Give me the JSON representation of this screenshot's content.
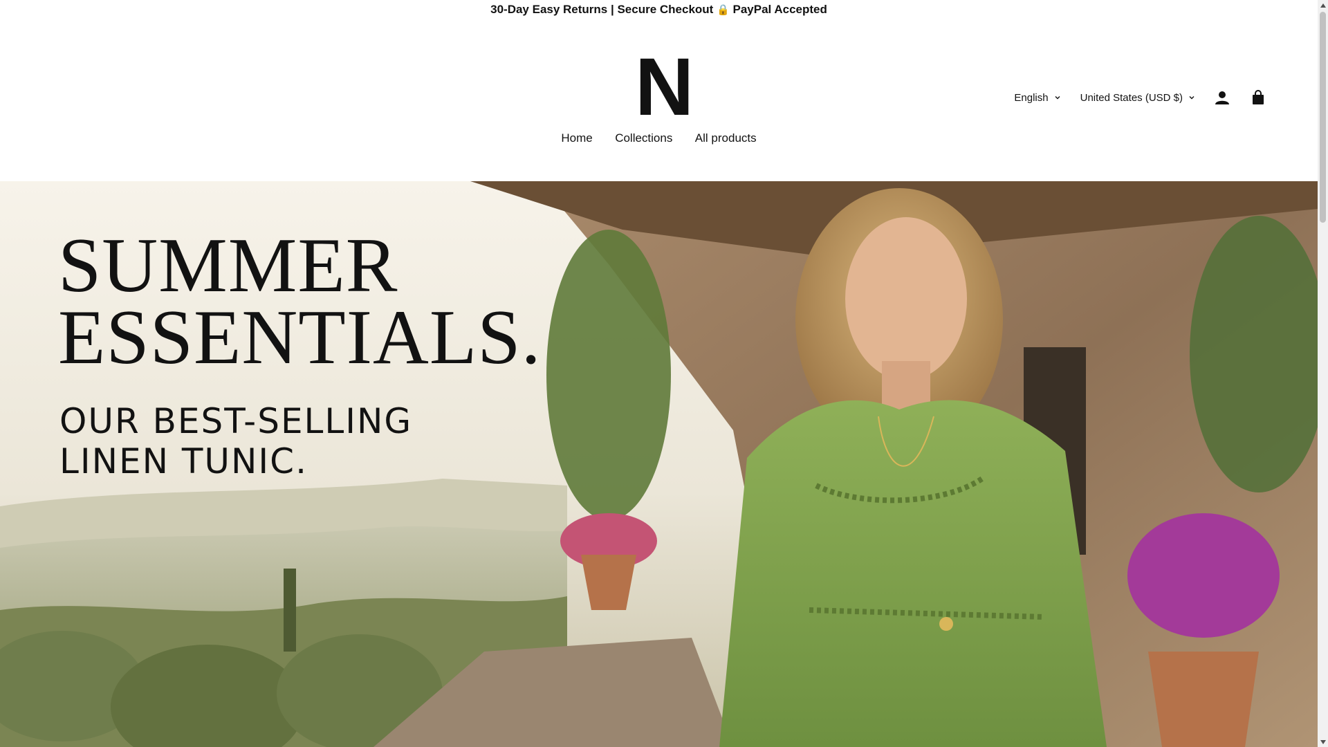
{
  "announcement": {
    "text_before": "30-Day Easy Returns | Secure Checkout ",
    "lock_glyph": "🔒",
    "text_after": " PayPal Accepted"
  },
  "logo": {
    "text": "N"
  },
  "header": {
    "language": "English",
    "currency": "United States (USD $)",
    "account_icon": "account-icon",
    "cart_icon": "cart-icon"
  },
  "nav": {
    "items": [
      {
        "label": "Home"
      },
      {
        "label": "Collections"
      },
      {
        "label": "All products"
      }
    ]
  },
  "hero": {
    "title_line1": "SUMMER",
    "title_line2": "ESSENTIALS.",
    "subtitle_line1": "OUR BEST-SELLING",
    "subtitle_line2": "LINEN TUNIC.",
    "image": "Woman in a green linen tunic on a stone terrace with flowers and a Tuscan countryside view"
  },
  "colors": {
    "text": "#121212",
    "background": "#ffffff",
    "tunic_green": "#86a84e"
  }
}
